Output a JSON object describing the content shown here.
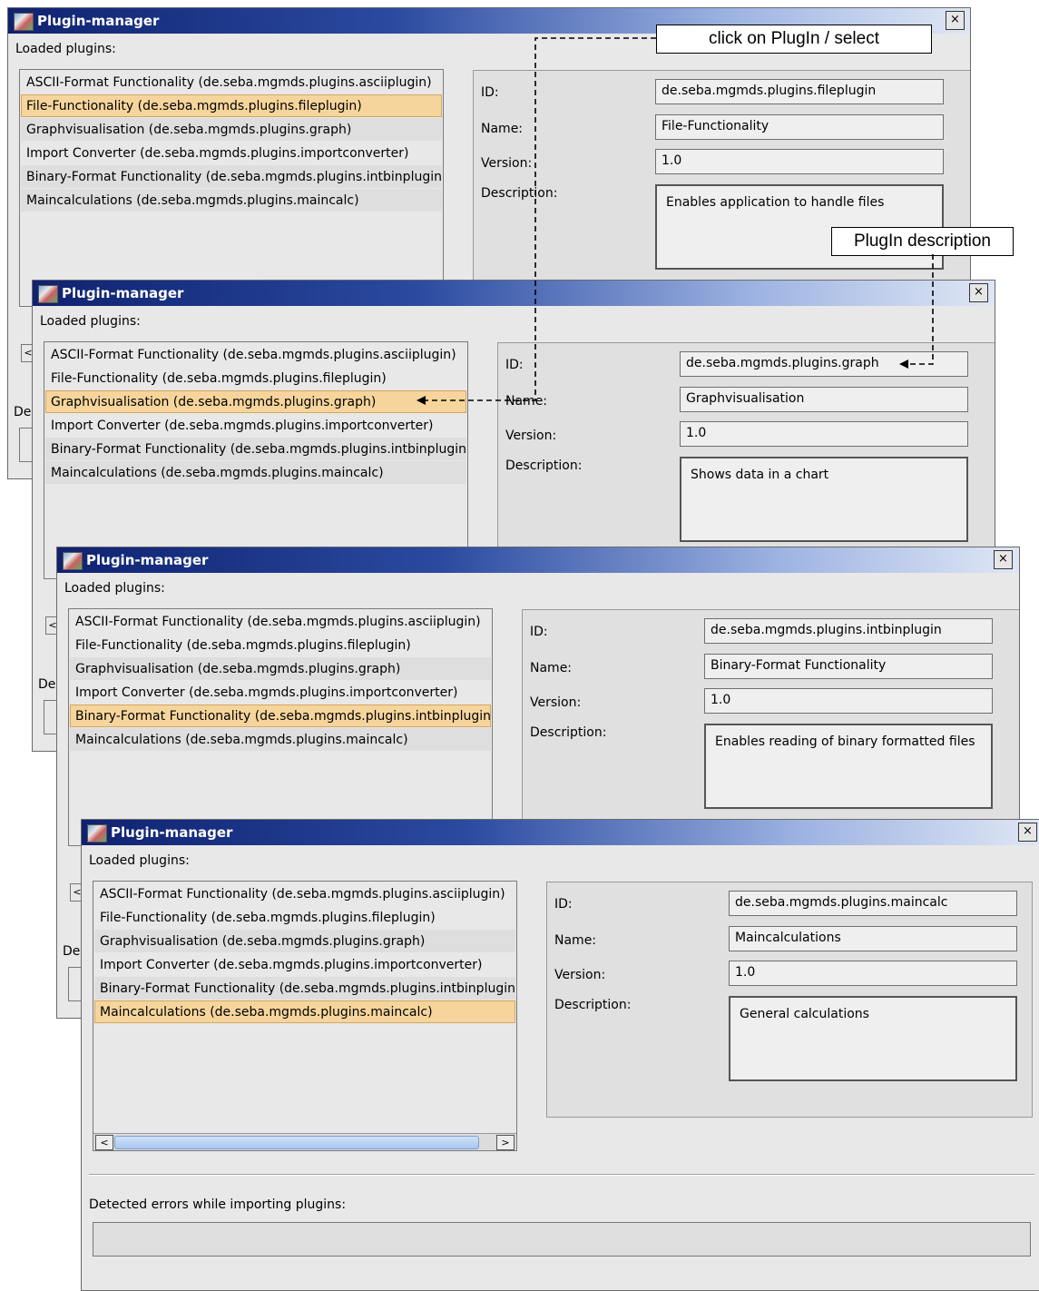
{
  "window": {
    "title": "Plugin-manager",
    "close_label": "×",
    "loaded_plugins_label": "Loaded plugins:",
    "errors_label": "Detected errors while importing plugins:",
    "errors_partial_label": "De"
  },
  "plugins": [
    "ASCII-Format Functionality (de.seba.mgmds.plugins.asciiplugin)",
    "File-Functionality (de.seba.mgmds.plugins.fileplugin)",
    "Graphvisualisation (de.seba.mgmds.plugins.graph)",
    "Import Converter (de.seba.mgmds.plugins.importconverter)",
    "Binary-Format Functionality (de.seba.mgmds.plugins.intbinplugin)",
    "Maincalculations (de.seba.mgmds.plugins.maincalc)"
  ],
  "field_labels": {
    "id": "ID:",
    "name": "Name:",
    "version": "Version:",
    "description": "Description:"
  },
  "windows": [
    {
      "selected_index": 1,
      "id": "de.seba.mgmds.plugins.fileplugin",
      "name": "File-Functionality",
      "version": "1.0",
      "description": "Enables application to handle files"
    },
    {
      "selected_index": 2,
      "id": "de.seba.mgmds.plugins.graph",
      "name": "Graphvisualisation",
      "version": "1.0",
      "description": "Shows data in a chart"
    },
    {
      "selected_index": 4,
      "id": "de.seba.mgmds.plugins.intbinplugin",
      "name": "Binary-Format Functionality",
      "version": "1.0",
      "description": "Enables reading of binary formatted files"
    },
    {
      "selected_index": 5,
      "id": "de.seba.mgmds.plugins.maincalc",
      "name": "Maincalculations",
      "version": "1.0",
      "description": "General calculations"
    }
  ],
  "scroll": {
    "left_arrow": "<",
    "right_arrow": ">"
  },
  "callouts": {
    "select": "click on PlugIn / select",
    "description": "PlugIn description"
  }
}
